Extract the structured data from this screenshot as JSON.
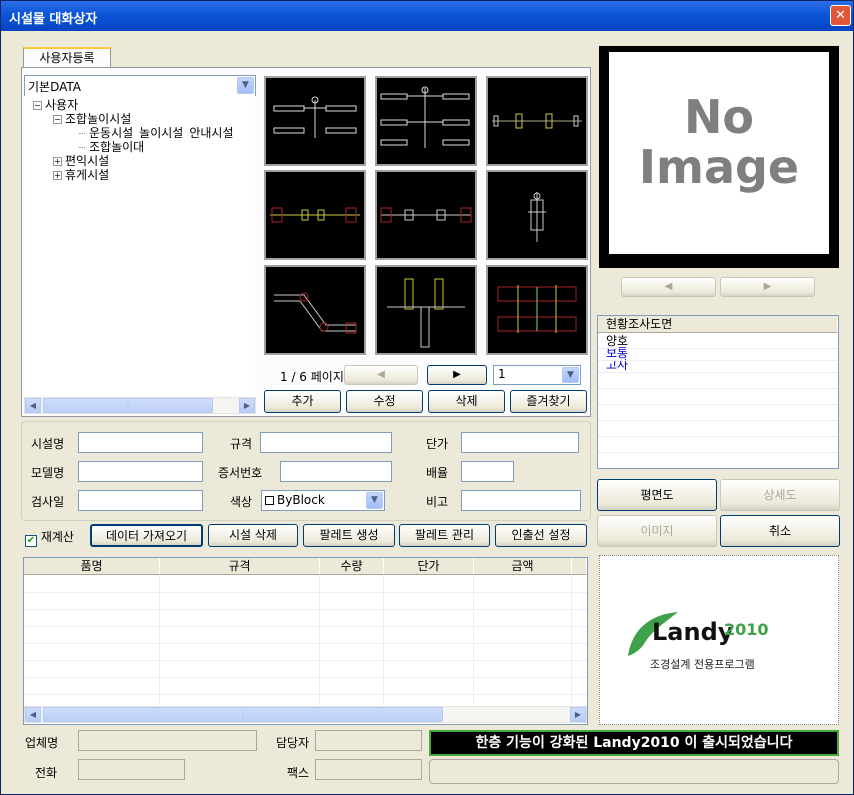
{
  "window": {
    "title": "시설물 대화상자",
    "close": "✕"
  },
  "tab": "사용자등록",
  "data_combo": "기본DATA",
  "tree": [
    {
      "text": "사용자",
      "toggle": "−"
    },
    {
      "text": "조합놀이시설",
      "toggle": "−"
    },
    {
      "text": "운동시설_놀이시설_안내시설"
    },
    {
      "text": "조합놀이대"
    },
    {
      "text": "편익시설",
      "toggle": "+"
    },
    {
      "text": "휴게시설",
      "toggle": "+"
    }
  ],
  "pager": {
    "text": "1 / 6  페이지",
    "page_select": "1"
  },
  "thumb_buttons": {
    "add": "추가",
    "edit": "수정",
    "delete": "삭제",
    "favorites": "즐겨찾기"
  },
  "form": {
    "facility_name_label": "시설명",
    "spec_label": "규격",
    "unit_price_label": "단가",
    "model_label": "모델명",
    "cert_no_label": "증서번호",
    "scale_label": "배율",
    "inspect_date_label": "검사일",
    "color_label": "색상",
    "color_value": "ByBlock",
    "remark_label": "비고"
  },
  "actions": {
    "recalc_label": "재계산",
    "recalc_checked": true,
    "import_data": "데이터 가져오기",
    "delete_facility": "시설 삭제",
    "create_palette": "팔레트 생성",
    "manage_palette": "팔레트 관리",
    "leader_settings": "인출선 설정"
  },
  "table": {
    "headers": [
      "품명",
      "규격",
      "수량",
      "단가",
      "금액"
    ]
  },
  "vendor": {
    "company_label": "업체명",
    "manager_label": "담당자",
    "phone_label": "전화",
    "fax_label": "팩스"
  },
  "banner": "한층 기능이 강화된 Landy2010 이 출시되었습니다",
  "preview": {
    "line1": "No",
    "line2": "Image"
  },
  "survey": {
    "header": "현황조사도면",
    "items": [
      "양호",
      "보통",
      "고사"
    ],
    "item_colors": [
      "#000000",
      "#0000cc",
      "#0000cc"
    ]
  },
  "right_buttons": {
    "plan": "평면도",
    "detail": "상세도",
    "image": "이미지",
    "cancel": "취소"
  },
  "logo": {
    "brand": "Landy",
    "year": "2010",
    "tagline": "조경설계 전용프로그램"
  }
}
